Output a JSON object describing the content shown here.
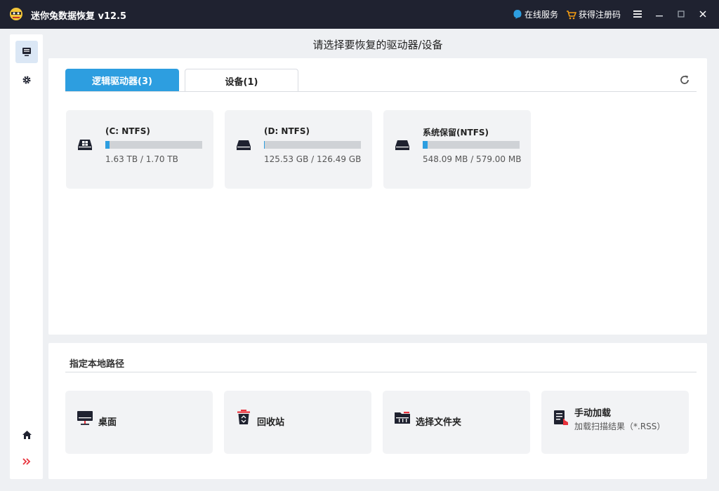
{
  "titlebar": {
    "app_title": "迷你兔数据恢复 v12.5",
    "online_service": "在线服务",
    "get_register_code": "获得注册码"
  },
  "header": {
    "title": "请选择要恢复的驱动器/设备"
  },
  "tabs": [
    {
      "label": "逻辑驱动器(3)",
      "active": true
    },
    {
      "label": "设备(1)",
      "active": false
    }
  ],
  "drives": [
    {
      "name": "(C: NTFS)",
      "size": "1.63 TB / 1.70 TB",
      "usage": 0.04,
      "icon": "windows-drive-icon"
    },
    {
      "name": "(D: NTFS)",
      "size": "125.53 GB / 126.49 GB",
      "usage": 0.01,
      "icon": "hard-drive-icon"
    },
    {
      "name": "系统保留(NTFS)",
      "size": "548.09 MB / 579.00 MB",
      "usage": 0.05,
      "icon": "hard-drive-icon"
    }
  ],
  "local_path": {
    "title": "指定本地路径",
    "items": [
      {
        "label": "桌面",
        "icon": "desktop-icon"
      },
      {
        "label": "回收站",
        "icon": "recycle-bin-icon"
      },
      {
        "label": "选择文件夹",
        "icon": "folder-icon"
      },
      {
        "label": "手动加载",
        "sub": "加载扫描结果（*.RSS）",
        "icon": "manual-load-icon"
      }
    ]
  },
  "colors": {
    "accent": "#2d9ee0",
    "titlebar": "#1f2230",
    "highlight_red": "#e8323c"
  }
}
